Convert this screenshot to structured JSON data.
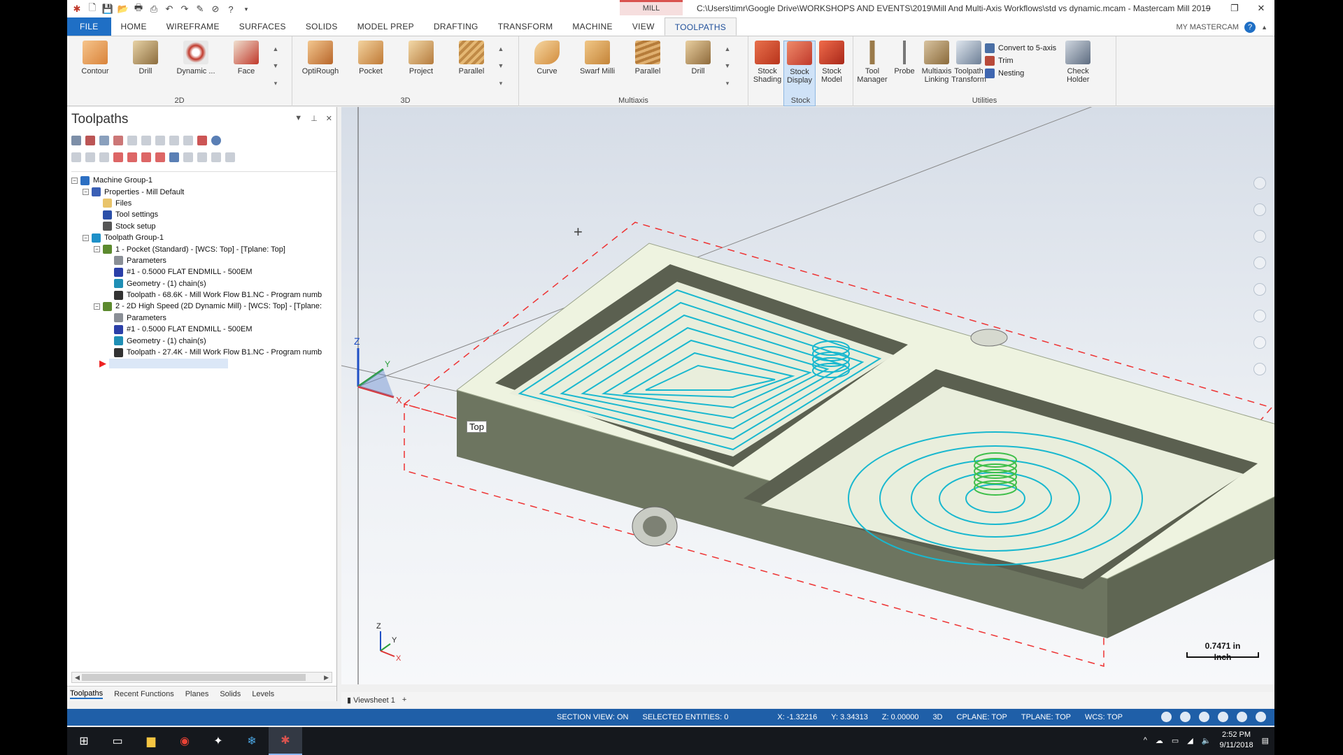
{
  "window": {
    "title": "C:\\Users\\timr\\Google Drive\\WORKSHOPS AND EVENTS\\2019\\Mill And Multi-Axis Workflows\\std vs dynamic.mcam - Mastercam Mill 2019",
    "context_tab": "MILL",
    "controls": [
      "–",
      "❐",
      "✕"
    ]
  },
  "menu": {
    "tabs": [
      "FILE",
      "HOME",
      "WIREFRAME",
      "SURFACES",
      "SOLIDS",
      "MODEL PREP",
      "DRAFTING",
      "TRANSFORM",
      "MACHINE",
      "VIEW",
      "TOOLPATHS"
    ],
    "active": "TOOLPATHS",
    "my_mastercam": "MY MASTERCAM"
  },
  "ribbon": {
    "group_2d": {
      "label": "2D",
      "buttons": [
        "Contour",
        "Drill",
        "Dynamic ...",
        "Face"
      ]
    },
    "group_3d": {
      "label": "3D",
      "buttons": [
        "OptiRough",
        "Pocket",
        "Project",
        "Parallel"
      ]
    },
    "group_multiaxis": {
      "label": "Multiaxis",
      "buttons": [
        "Curve",
        "Swarf Milli",
        "Parallel",
        "Drill"
      ]
    },
    "group_stock": {
      "label": "Stock",
      "buttons": [
        "Stock Shading",
        "Stock Display",
        "Stock Model"
      ]
    },
    "group_utilities": {
      "label": "Utilities",
      "buttons": [
        "Tool Manager",
        "Probe",
        "Multiaxis Linking",
        "Toolpath Transform"
      ],
      "small": [
        "Convert to 5-axis",
        "Trim",
        "Nesting"
      ],
      "check_holder": "Check Holder"
    }
  },
  "panel": {
    "title": "Toolpaths",
    "tree": [
      {
        "text": "Machine Group-1",
        "level": 0,
        "exp": "−",
        "icon": "#2c6fc2"
      },
      {
        "text": "Properties - Mill Default",
        "level": 1,
        "exp": "−",
        "icon": "#3a5fb5"
      },
      {
        "text": "Files",
        "level": 2,
        "icon": "#e9c46a"
      },
      {
        "text": "Tool settings",
        "level": 2,
        "icon": "#2b4fa8"
      },
      {
        "text": "Stock setup",
        "level": 2,
        "icon": "#555"
      },
      {
        "text": "Toolpath Group-1",
        "level": 1,
        "exp": "−",
        "icon": "#1e90c8"
      },
      {
        "text": "1 - Pocket (Standard) - [WCS: Top] - [Tplane: Top]",
        "level": 2,
        "exp": "−",
        "icon": "#5c8a2e"
      },
      {
        "text": "Parameters",
        "level": 3,
        "icon": "#8a8f96"
      },
      {
        "text": "#1 - 0.5000 FLAT ENDMILL - 500EM",
        "level": 3,
        "icon": "#2b3fa8"
      },
      {
        "text": "Geometry - (1) chain(s)",
        "level": 3,
        "icon": "#1f8fb5"
      },
      {
        "text": "Toolpath - 68.6K - Mill Work Flow B1.NC - Program numb",
        "level": 3,
        "icon": "#333"
      },
      {
        "text": "2 - 2D High Speed (2D Dynamic Mill) - [WCS: Top] - [Tplane:",
        "level": 2,
        "exp": "−",
        "icon": "#5c8a2e"
      },
      {
        "text": "Parameters",
        "level": 3,
        "icon": "#8a8f96"
      },
      {
        "text": "#1 - 0.5000 FLAT ENDMILL - 500EM",
        "level": 3,
        "icon": "#2b3fa8"
      },
      {
        "text": "Geometry - (1) chain(s)",
        "level": 3,
        "icon": "#1f8fb5"
      },
      {
        "text": "Toolpath - 27.4K - Mill Work Flow B1.NC - Program numb",
        "level": 3,
        "icon": "#333"
      }
    ],
    "bottom_tabs": [
      "Toolpaths",
      "Recent Functions",
      "Planes",
      "Solids",
      "Levels"
    ]
  },
  "viewport": {
    "view_label": "Top",
    "scale_value": "0.7471 in",
    "scale_unit": "Inch",
    "axis_labels": [
      "Z",
      "Y",
      "X"
    ],
    "viewsheet": "Viewsheet 1"
  },
  "status": {
    "section_view": "SECTION VIEW: ON",
    "selected": "SELECTED ENTITIES: 0",
    "x": "X:   -1.32216",
    "y": "Y:   3.34313",
    "z": "Z:   0.00000",
    "mode": "3D",
    "cplane": "CPLANE: TOP",
    "tplane": "TPLANE: TOP",
    "wcs": "WCS: TOP"
  },
  "taskbar": {
    "time": "2:52 PM",
    "date": "9/11/2018"
  }
}
